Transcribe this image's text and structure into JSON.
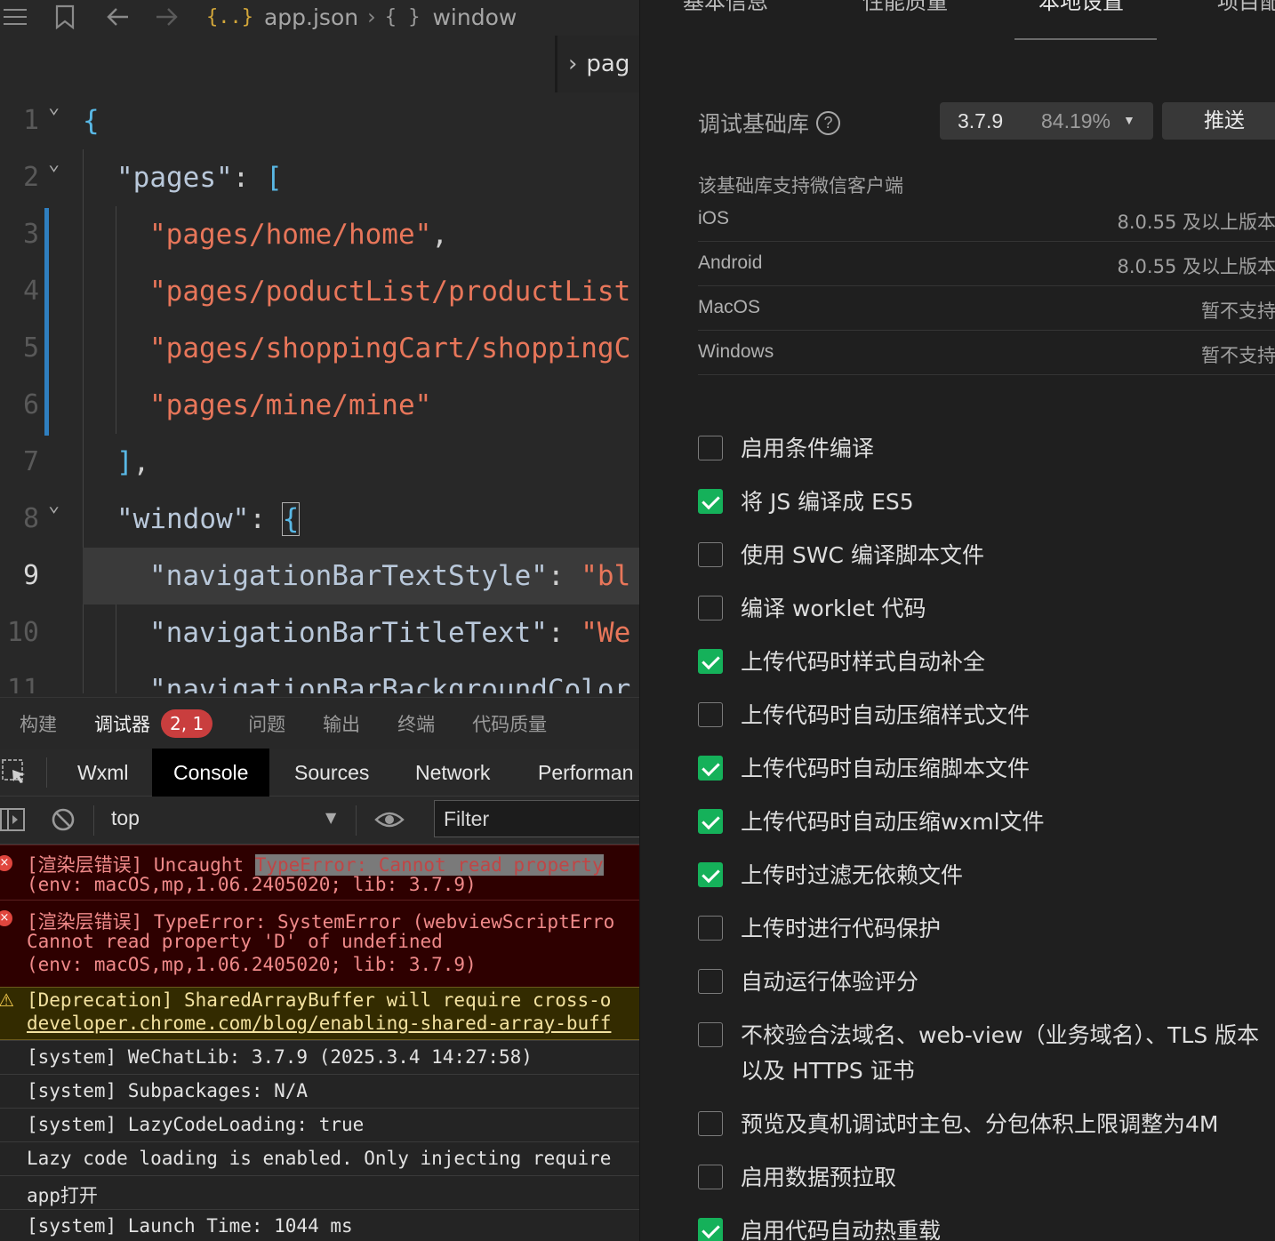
{
  "editor": {
    "breadcrumb": {
      "file": "app.json",
      "symbol": "window",
      "file_icon": "{..}",
      "symbol_icon": "{ }"
    },
    "sticky_scroll": "pag",
    "lines": [
      {
        "n": "1",
        "parts": [
          [
            "br",
            "{"
          ]
        ]
      },
      {
        "n": "2",
        "parts": [
          [
            "k",
            "\"pages\""
          ],
          [
            "p",
            ": "
          ],
          [
            "br",
            "["
          ]
        ]
      },
      {
        "n": "3",
        "parts": [
          [
            "s",
            "\"pages/home/home\""
          ],
          [
            "p",
            ","
          ]
        ]
      },
      {
        "n": "4",
        "parts": [
          [
            "s",
            "\"pages/poductList/productList"
          ]
        ]
      },
      {
        "n": "5",
        "parts": [
          [
            "s",
            "\"pages/shoppingCart/shoppingC"
          ]
        ]
      },
      {
        "n": "6",
        "parts": [
          [
            "s",
            "\"pages/mine/mine\""
          ]
        ]
      },
      {
        "n": "7",
        "parts": [
          [
            "br",
            "]"
          ],
          [
            "p",
            ","
          ]
        ]
      },
      {
        "n": "8",
        "parts": [
          [
            "k",
            "\"window\""
          ],
          [
            "p",
            ": "
          ],
          [
            "brbox",
            "{"
          ]
        ]
      },
      {
        "n": "9",
        "parts": [
          [
            "k",
            "\"navigationBarTextStyle\""
          ],
          [
            "p",
            ": "
          ],
          [
            "s",
            "\"bl"
          ]
        ]
      },
      {
        "n": "10",
        "parts": [
          [
            "k",
            "\"navigationBarTitleText\""
          ],
          [
            "p",
            ": "
          ],
          [
            "s",
            "\"We"
          ]
        ]
      },
      {
        "n": "11",
        "parts": [
          [
            "k",
            "\"navigationBarBackgroundColor"
          ]
        ]
      }
    ]
  },
  "panel": {
    "tabs": [
      "构建",
      "调试器",
      "问题",
      "输出",
      "终端",
      "代码质量"
    ],
    "active_tab": "调试器",
    "badge": "2, 1"
  },
  "devtools": {
    "tabs": [
      "Wxml",
      "Console",
      "Sources",
      "Network",
      "Performan"
    ],
    "active": "Console",
    "context": "top",
    "filter_placeholder": "Filter"
  },
  "console": {
    "err1_prefix": "[渲染层错误] Uncaught ",
    "err1_highlight": "TypeError: Cannot read property",
    "err1_line2": "(env: macOS,mp,1.06.2405020; lib: 3.7.9)",
    "err2_line1": "[渲染层错误] TypeError: SystemError (webviewScriptErro",
    "err2_line2": "Cannot read property 'D' of undefined",
    "err2_line3": "(env: macOS,mp,1.06.2405020; lib: 3.7.9)",
    "warn_line1": "[Deprecation] SharedArrayBuffer will require cross-o",
    "warn_line2": "developer.chrome.com/blog/enabling-shared-array-buff",
    "logs": [
      "[system] WeChatLib: 3.7.9 (2025.3.4 14:27:58)",
      "[system] Subpackages: N/A",
      "[system] LazyCodeLoading: true",
      "Lazy code loading is enabled. Only injecting require",
      "app打开",
      "[system] Launch Time: 1044 ms"
    ]
  },
  "settings": {
    "tabs": [
      "基本信息",
      "性能质量",
      "本地设置",
      "项目配"
    ],
    "active_tab": "本地设置",
    "lib_label": "调试基础库",
    "lib_help": "?",
    "lib_version": "3.7.9",
    "lib_percent": "84.19%",
    "push_label": "推送",
    "support_title": "该基础库支持微信客户端",
    "os": [
      {
        "name": "iOS",
        "value": "8.0.55 及以上版本"
      },
      {
        "name": "Android",
        "value": "8.0.55 及以上版本"
      },
      {
        "name": "MacOS",
        "value": "暂不支持"
      },
      {
        "name": "Windows",
        "value": "暂不支持"
      }
    ],
    "options": [
      {
        "label": "启用条件编译",
        "checked": false
      },
      {
        "label": "将 JS 编译成 ES5",
        "checked": true
      },
      {
        "label": "使用 SWC 编译脚本文件",
        "checked": false
      },
      {
        "label": "编译 worklet 代码",
        "checked": false
      },
      {
        "label": "上传代码时样式自动补全",
        "checked": true
      },
      {
        "label": "上传代码时自动压缩样式文件",
        "checked": false
      },
      {
        "label": "上传代码时自动压缩脚本文件",
        "checked": true
      },
      {
        "label": "上传代码时自动压缩wxml文件",
        "checked": true
      },
      {
        "label": "上传时过滤无依赖文件",
        "checked": true
      },
      {
        "label": "上传时进行代码保护",
        "checked": false
      },
      {
        "label": "自动运行体验评分",
        "checked": false
      },
      {
        "label": "不校验合法域名、web-view（业务域名）、TLS 版本以及 HTTPS 证书",
        "checked": false
      },
      {
        "label": "预览及真机调试时主包、分包体积上限调整为4M",
        "checked": false
      },
      {
        "label": "启用数据预拉取",
        "checked": false
      },
      {
        "label": "启用代码自动热重载",
        "checked": true
      }
    ]
  }
}
